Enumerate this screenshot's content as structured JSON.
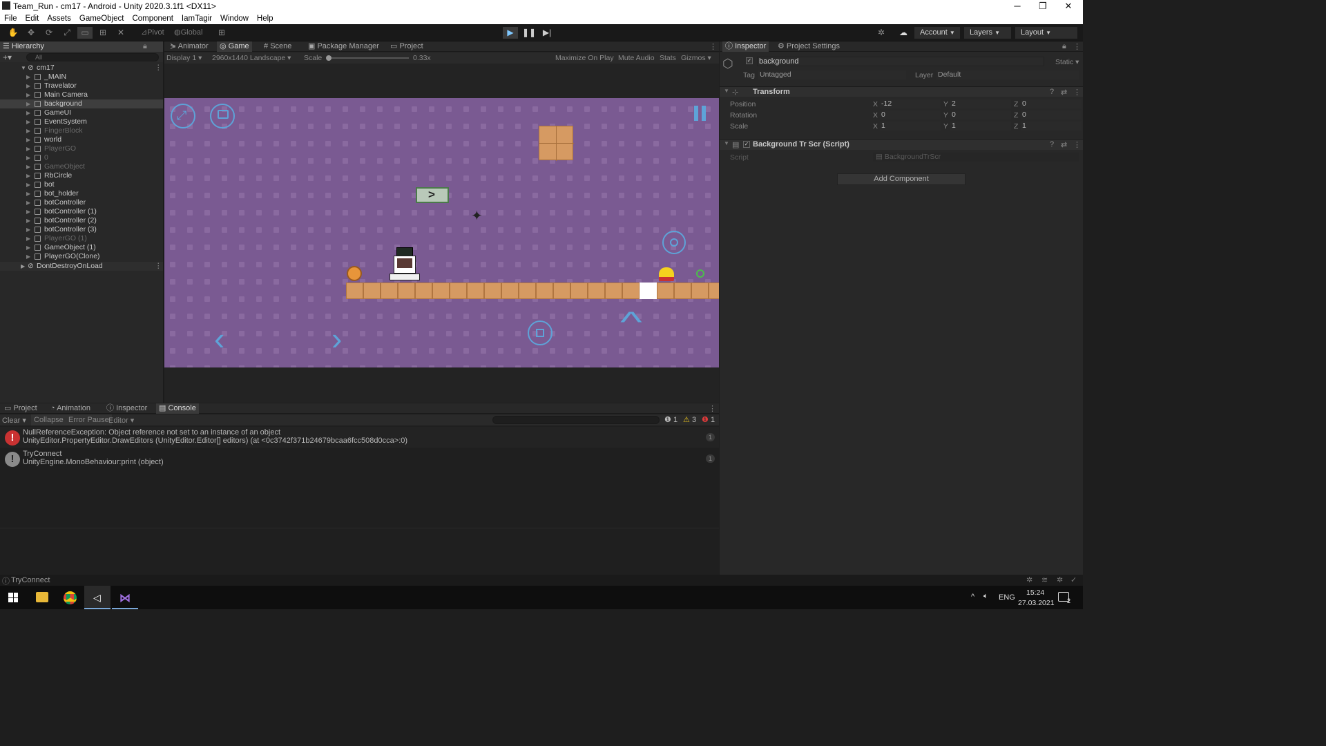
{
  "window": {
    "title": "Team_Run - cm17 - Android - Unity 2020.3.1f1 <DX11>",
    "min": "─",
    "max": "❐",
    "close": "✕"
  },
  "menu": [
    "File",
    "Edit",
    "Assets",
    "GameObject",
    "Component",
    "IamTagir",
    "Window",
    "Help"
  ],
  "toolbar": {
    "pivot": "Pivot",
    "global": "Global",
    "account": "Account",
    "layers": "Layers",
    "layout": "Layout"
  },
  "hierarchy": {
    "tab": "Hierarchy",
    "search_placeholder": "All",
    "scene": "cm17",
    "items": [
      {
        "label": "_MAIN",
        "dim": false
      },
      {
        "label": "Travelator",
        "dim": false
      },
      {
        "label": "Main Camera",
        "dim": false
      },
      {
        "label": "background",
        "dim": false,
        "selected": true
      },
      {
        "label": "GameUI",
        "dim": false
      },
      {
        "label": "EventSystem",
        "dim": false
      },
      {
        "label": "FingerBlock",
        "dim": true
      },
      {
        "label": "world",
        "dim": false
      },
      {
        "label": "PlayerGO",
        "dim": true
      },
      {
        "label": "0",
        "dim": true
      },
      {
        "label": "GameObject",
        "dim": true
      },
      {
        "label": "RbCircle",
        "dim": false
      },
      {
        "label": "bot",
        "dim": false
      },
      {
        "label": "bot_holder",
        "dim": false
      },
      {
        "label": "botController",
        "dim": false
      },
      {
        "label": "botController (1)",
        "dim": false
      },
      {
        "label": "botController (2)",
        "dim": false
      },
      {
        "label": "botController (3)",
        "dim": false
      },
      {
        "label": "PlayerGO (1)",
        "dim": true
      },
      {
        "label": "GameObject (1)",
        "dim": false
      },
      {
        "label": "PlayerGO(Clone)",
        "dim": false
      }
    ],
    "ddol": "DontDestroyOnLoad"
  },
  "gametabs": [
    "Animator",
    "Game",
    "Scene",
    "Package Manager",
    "Project"
  ],
  "gamebar": {
    "display": "Display 1",
    "resolution": "2960x1440 Landscape",
    "scale_label": "Scale",
    "scale_value": "0.33x",
    "maximize": "Maximize On Play",
    "mute": "Mute Audio",
    "stats": "Stats",
    "gizmos": "Gizmos"
  },
  "inspector": {
    "tabs": [
      "Inspector",
      "Project Settings"
    ],
    "object_name": "background",
    "static": "Static",
    "tag_label": "Tag",
    "tag_value": "Untagged",
    "layer_label": "Layer",
    "layer_value": "Default",
    "transform": "Transform",
    "position_label": "Position",
    "rotation_label": "Rotation",
    "scale_label": "Scale",
    "position": {
      "x": "-12",
      "y": "2",
      "z": "0"
    },
    "rotation": {
      "x": "0",
      "y": "0",
      "z": "0"
    },
    "scale": {
      "x": "1",
      "y": "1",
      "z": "1"
    },
    "script_component": "Background Tr Scr (Script)",
    "script_label": "Script",
    "script_value": "BackgroundTrScr",
    "add_component": "Add Component"
  },
  "consoletabs": [
    "Project",
    "Animation",
    "Inspector",
    "Console"
  ],
  "console": {
    "clear": "Clear",
    "collapse": "Collapse",
    "error_pause": "Error Pause",
    "editor": "Editor",
    "counts": {
      "info": "1",
      "warn": "3",
      "error": "1"
    },
    "entries": [
      {
        "line1": "NullReferenceException: Object reference not set to an instance of an object",
        "line2": "UnityEditor.PropertyEditor.DrawEditors (UnityEditor.Editor[] editors) (at <0c3742f371b24679bcaa6fcc508d0cca>:0)",
        "count": "1",
        "type": "error"
      },
      {
        "line1": "TryConnect",
        "line2": "UnityEngine.MonoBehaviour:print (object)",
        "count": "1",
        "type": "info"
      }
    ]
  },
  "status": "TryConnect",
  "taskbar": {
    "lang": "ENG",
    "time": "15:24",
    "date": "27.03.2021",
    "notif": "2"
  },
  "colors": {
    "game_bg": "#7a5a92",
    "accent": "#5ea3d8",
    "tile": "#d69a62"
  }
}
